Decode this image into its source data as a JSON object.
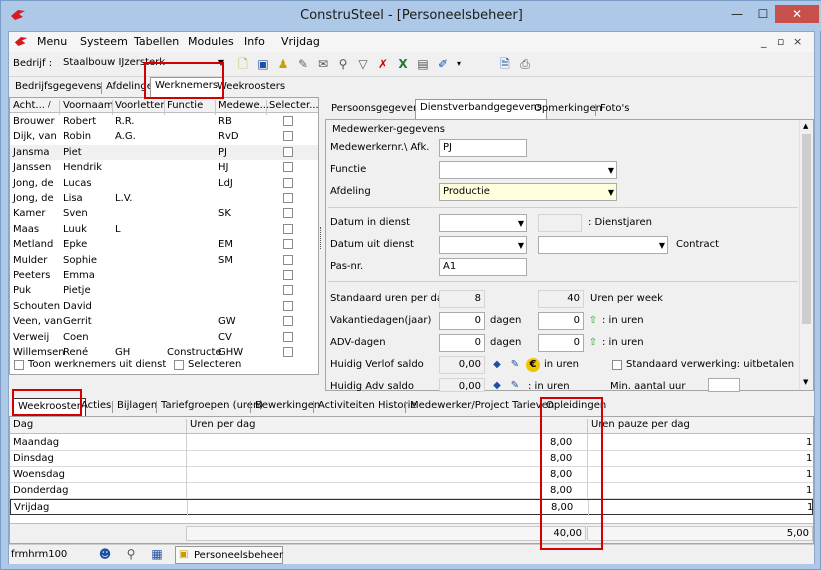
{
  "window": {
    "title": "ConstruSteel - [Personeelsbeheer]",
    "minimize": "—",
    "maximize": "☐",
    "close": "✕"
  },
  "menu": {
    "items": [
      "Menu",
      "Systeem",
      "Tabellen",
      "Modules",
      "Info",
      "Vrijdag"
    ],
    "mdi": [
      "_",
      "▫",
      "×"
    ]
  },
  "toolbar": {
    "company_label": "Bedrijf :",
    "company_value": "Staalbouw IJzersterk"
  },
  "top_tabs": [
    "Bedrijfsgegevens",
    "Afdelingen",
    "Werknemers",
    "Weekroosters"
  ],
  "employees": {
    "columns": [
      "Acht...",
      "/",
      "Voornaam",
      "Voorletters",
      "Functie",
      "Medewe...",
      "Selecter..."
    ],
    "rows": [
      {
        "last": "Brouwer",
        "first": "Robert",
        "initials": "R.R.",
        "function": "",
        "code": "RB"
      },
      {
        "last": "Dijk, van",
        "first": "Robin",
        "initials": "A.G.",
        "function": "",
        "code": "RvD"
      },
      {
        "last": "Jansma",
        "first": "Piet",
        "initials": "",
        "function": "",
        "code": "PJ"
      },
      {
        "last": "Janssen",
        "first": "Hendrik",
        "initials": "",
        "function": "",
        "code": "HJ"
      },
      {
        "last": "Jong, de",
        "first": "Lucas",
        "initials": "",
        "function": "",
        "code": "LdJ"
      },
      {
        "last": "Jong, de",
        "first": "Lisa",
        "initials": "L.V.",
        "function": "",
        "code": ""
      },
      {
        "last": "Kamer",
        "first": "Sven",
        "initials": "",
        "function": "",
        "code": "SK"
      },
      {
        "last": "Maas",
        "first": "Luuk",
        "initials": "L",
        "function": "",
        "code": ""
      },
      {
        "last": "Metland",
        "first": "Epke",
        "initials": "",
        "function": "",
        "code": "EM"
      },
      {
        "last": "Mulder",
        "first": "Sophie",
        "initials": "",
        "function": "",
        "code": "SM"
      },
      {
        "last": "Peeters",
        "first": "Emma",
        "initials": "",
        "function": "",
        "code": ""
      },
      {
        "last": "Puk",
        "first": "Pietje",
        "initials": "",
        "function": "",
        "code": ""
      },
      {
        "last": "Schouten",
        "first": "David",
        "initials": "",
        "function": "",
        "code": ""
      },
      {
        "last": "Veen, van",
        "first": "Gerrit",
        "initials": "",
        "function": "",
        "code": "GW"
      },
      {
        "last": "Verweij",
        "first": "Coen",
        "initials": "",
        "function": "",
        "code": "CV"
      },
      {
        "last": "Willemsen",
        "first": "René",
        "initials": "GH",
        "function": "Constructe",
        "code": "GHW"
      }
    ],
    "show_out_of_service": "Toon werknemers uit dienst",
    "select_label": "Selecteren"
  },
  "detail_tabs": [
    "Persoonsgegevens",
    "Dienstverbandgegevens",
    "Opmerkingen",
    "Foto's"
  ],
  "detail": {
    "section": "Medewerker-gegevens",
    "emp_no_label": "Medewerkernr.\\ Afk.",
    "emp_no_value": "PJ",
    "function_label": "Functie",
    "function_value": "",
    "department_label": "Afdeling",
    "department_value": "Productie",
    "start_label": "Datum in dienst",
    "years_label": ": Dienstjaren",
    "end_label": "Datum uit dienst",
    "contract_label": "Contract",
    "pass_label": "Pas-nr.",
    "pass_value": "A1",
    "std_hours_label": "Standaard uren per dag",
    "std_hours_value": "8",
    "week_hours_value": "40",
    "week_hours_label": "Uren per week",
    "vacation_label": "Vakantiedagen(jaar)",
    "vacation_value": "0",
    "days_label": "dagen",
    "vacation_hours": "0",
    "in_hours_label": ": in uren",
    "adv_label": "ADV-dagen",
    "adv_value": "0",
    "adv_days_label": "dagen",
    "adv_hours": "0",
    "adv_in_hours": ": in uren",
    "leave_label": "Huidig Verlof saldo",
    "leave_value": "0,00",
    "leave_in_hours": "in uren",
    "std_processing": "Standaard verwerking: uitbetalen",
    "adv_balance_label": "Huidig Adv saldo",
    "adv_balance_value": "0,00",
    "adv_balance_hours": ": in uren",
    "min_hours_label": "Min. aantal uur"
  },
  "bottom_tabs": [
    "Weekrooster",
    "Acties",
    "Bijlagen",
    "Tariefgroepen (uren)",
    "Bewerkingen",
    "Activiteiten Historie",
    "Medewerker/Project Tarieven",
    "Opleidingen"
  ],
  "schedule": {
    "columns": [
      "Dag",
      "Uren per dag",
      "Uren pauze per dag"
    ],
    "rows": [
      {
        "day": "Maandag",
        "hours": "8,00",
        "pause": "1"
      },
      {
        "day": "Dinsdag",
        "hours": "8,00",
        "pause": "1"
      },
      {
        "day": "Woensdag",
        "hours": "8,00",
        "pause": "1"
      },
      {
        "day": "Donderdag",
        "hours": "8,00",
        "pause": "1"
      },
      {
        "day": "Vrijdag",
        "hours": "8,00",
        "pause": "1"
      }
    ],
    "total_hours": "40,00",
    "total_pause": "5,00"
  },
  "status": {
    "form": "frmhrm100",
    "task": "Personeelsbeheer"
  },
  "colors": {
    "accent_red": "#d40000",
    "highlight_yellow": "#ffffdd"
  }
}
